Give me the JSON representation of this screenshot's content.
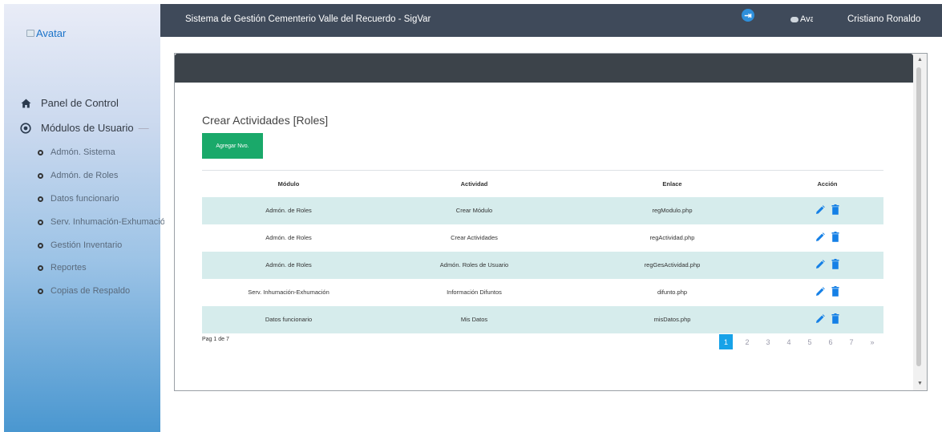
{
  "sidebar": {
    "avatar_alt": "Avatar",
    "items": [
      {
        "label": "Panel de Control",
        "icon": "home-icon"
      },
      {
        "label": "Módulos de Usuario",
        "icon": "target-icon",
        "suffix": "—"
      }
    ],
    "subitems": [
      {
        "label": "Admón. Sistema"
      },
      {
        "label": "Admón. de Roles"
      },
      {
        "label": "Datos funcionario"
      },
      {
        "label": "Serv. Inhumación-Exhumación"
      },
      {
        "label": "Gestión Inventario"
      },
      {
        "label": "Reportes"
      },
      {
        "label": "Copias de Respaldo"
      }
    ]
  },
  "topbar": {
    "title": "Sistema de Gestión Cementerio Valle del Recuerdo - SigVar",
    "exit_icon": "exit-icon",
    "user_avatar_alt": "Avatar",
    "username": "Cristiano Ronaldo"
  },
  "main": {
    "section_title": "Crear Actividades [Roles]",
    "add_button": "Agregar Nvo.",
    "table": {
      "headers": [
        "Módulo",
        "Actividad",
        "Enlace",
        "Acción"
      ],
      "rows": [
        [
          "Admón. de Roles",
          "Crear Módulo",
          "regModulo.php"
        ],
        [
          "Admón. de Roles",
          "Crear Actividades",
          "regActividad.php"
        ],
        [
          "Admón. de Roles",
          "Admón. Roles de Usuario",
          "regGesActividad.php"
        ],
        [
          "Serv. Inhumación-Exhumación",
          "Información Difuntos",
          "difunto.php"
        ],
        [
          "Datos funcionario",
          "Mis Datos",
          "misDatos.php"
        ]
      ]
    },
    "pagination_info": "Pag 1 de 7",
    "pages": [
      "1",
      "2",
      "3",
      "4",
      "5",
      "6",
      "7",
      "»"
    ],
    "active_page": "1"
  },
  "colors": {
    "accent": "#17a2e8",
    "add_button": "#1aa96a",
    "topbar": "#3f4a5a",
    "row_highlight": "#d6ecec",
    "action_icon": "#1580e6"
  }
}
